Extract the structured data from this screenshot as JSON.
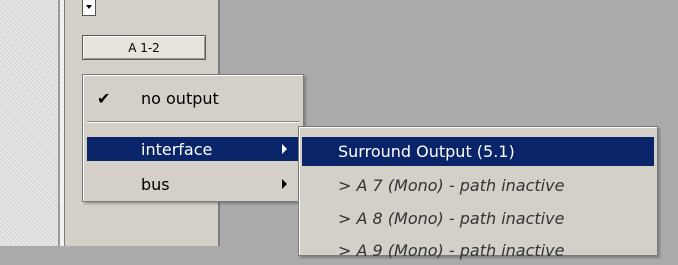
{
  "channel": {
    "output_button_label": "A 1-2"
  },
  "output_menu": {
    "checkmark": "✔",
    "items": [
      {
        "label": "no output",
        "checked": true
      },
      {
        "label": "interface",
        "highlighted": true,
        "has_submenu": true
      },
      {
        "label": "bus",
        "has_submenu": true
      }
    ]
  },
  "interface_submenu": {
    "items": [
      {
        "label": "Surround Output (5.1)",
        "highlighted": true
      },
      {
        "label": "> A 7 (Mono) - path inactive",
        "inactive": true
      },
      {
        "label": "> A 8 (Mono) - path inactive",
        "inactive": true
      },
      {
        "label": "> A 9 (Mono) - path inactive",
        "inactive": true
      }
    ]
  },
  "colors": {
    "highlight": "#0a246a",
    "menu_background": "#d4d0c8",
    "workspace_background": "#ababab"
  }
}
